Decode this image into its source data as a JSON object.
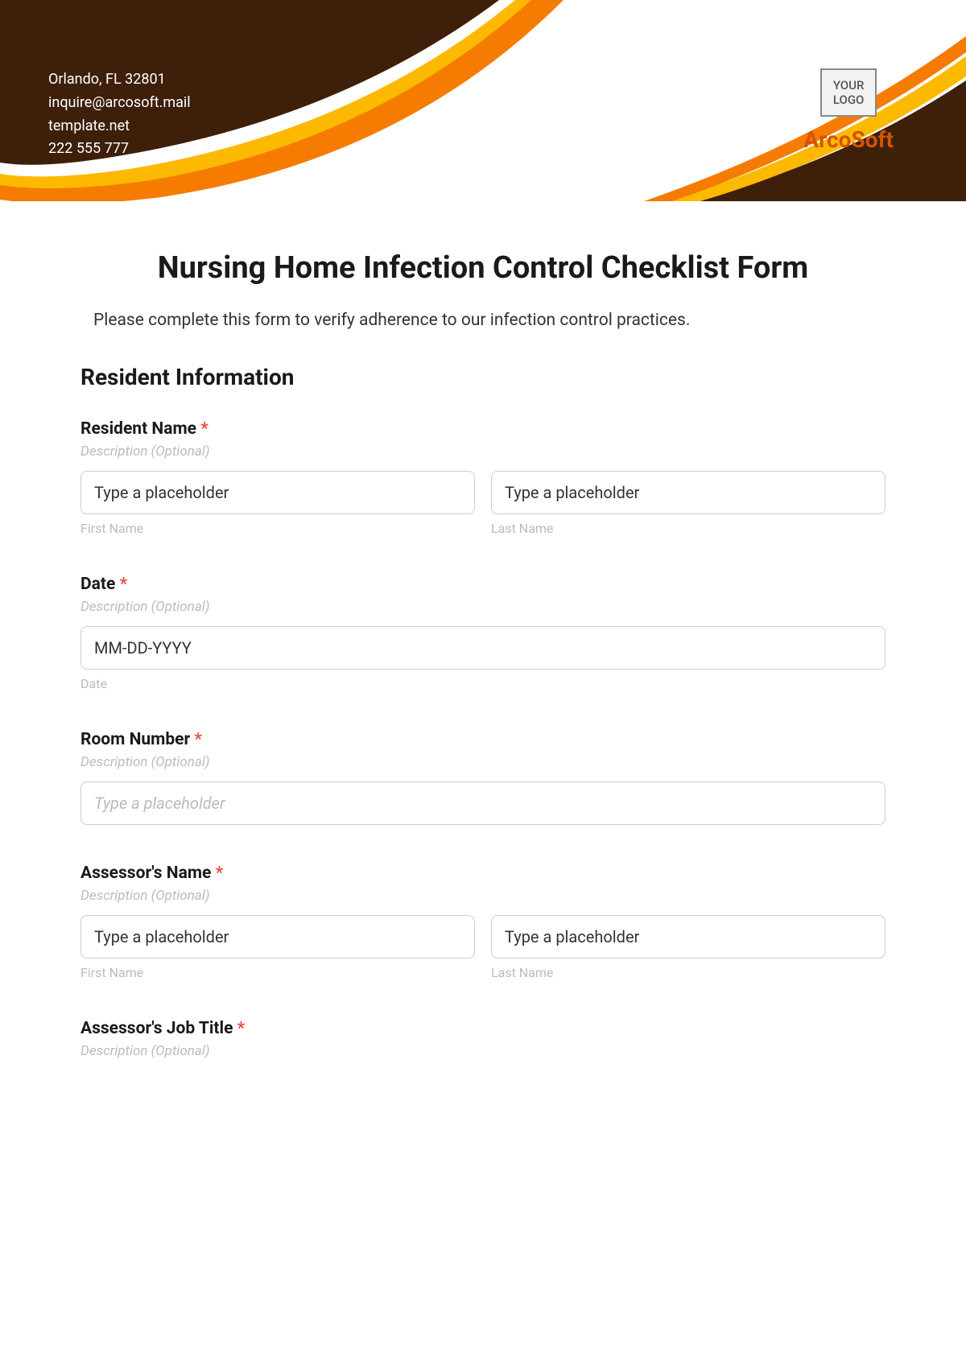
{
  "header": {
    "contact": {
      "line1": "Orlando, FL 32801",
      "line2": "inquire@arcosoft.mail",
      "line3": "template.net",
      "line4": "222 555 777"
    },
    "logo_text_line1": "YOUR",
    "logo_text_line2": "LOGO",
    "company": "ArcoSoft"
  },
  "form": {
    "title": "Nursing Home Infection Control Checklist Form",
    "intro": "Please complete this form to verify adherence to our infection control practices.",
    "section1_title": "Resident Information",
    "desc_placeholder": "Description (Optional)",
    "type_placeholder": "Type a placeholder",
    "fields": {
      "resident_name": {
        "label": "Resident Name",
        "first_sub": "First Name",
        "last_sub": "Last Name"
      },
      "date": {
        "label": "Date",
        "placeholder": "MM-DD-YYYY",
        "sub": "Date"
      },
      "room_number": {
        "label": "Room Number"
      },
      "assessor_name": {
        "label": "Assessor's Name",
        "first_sub": "First Name",
        "last_sub": "Last Name"
      },
      "assessor_job": {
        "label": "Assessor's Job Title"
      }
    },
    "required_mark": "*"
  }
}
